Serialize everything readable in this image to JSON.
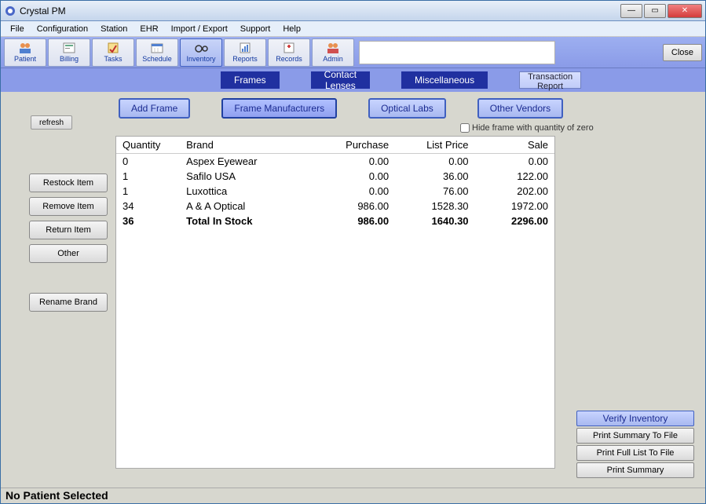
{
  "window": {
    "title": "Crystal PM"
  },
  "menubar": [
    "File",
    "Configuration",
    "Station",
    "EHR",
    "Import / Export",
    "Support",
    "Help"
  ],
  "toolbar": {
    "items": [
      {
        "label": "Patient",
        "name": "patient"
      },
      {
        "label": "Billing",
        "name": "billing"
      },
      {
        "label": "Tasks",
        "name": "tasks"
      },
      {
        "label": "Schedule",
        "name": "schedule"
      },
      {
        "label": "Inventory",
        "name": "inventory",
        "active": true
      },
      {
        "label": "Reports",
        "name": "reports"
      },
      {
        "label": "Records",
        "name": "records"
      },
      {
        "label": "Admin",
        "name": "admin"
      }
    ],
    "close_label": "Close"
  },
  "subnav": {
    "frames": "Frames",
    "contact_lenses": "Contact Lenses",
    "miscellaneous": "Miscellaneous",
    "tx_report": "Transaction Report"
  },
  "actions": {
    "refresh": "refresh",
    "add_frame": "Add Frame",
    "frame_manufacturers": "Frame Manufacturers",
    "optical_labs": "Optical Labs",
    "other_vendors": "Other Vendors",
    "hide_zero": "Hide frame with quantity of zero"
  },
  "side_buttons": {
    "restock": "Restock Item",
    "remove": "Remove Item",
    "return": "Return Item",
    "other": "Other",
    "rename": "Rename Brand"
  },
  "table": {
    "headers": {
      "quantity": "Quantity",
      "brand": "Brand",
      "purchase": "Purchase",
      "list_price": "List Price",
      "sale": "Sale"
    },
    "rows": [
      {
        "quantity": "0",
        "brand": "Aspex Eyewear",
        "purchase": "0.00",
        "list_price": "0.00",
        "sale": "0.00"
      },
      {
        "quantity": "1",
        "brand": "Safilo USA",
        "purchase": "0.00",
        "list_price": "36.00",
        "sale": "122.00"
      },
      {
        "quantity": "1",
        "brand": "Luxottica",
        "purchase": "0.00",
        "list_price": "76.00",
        "sale": "202.00"
      },
      {
        "quantity": "34",
        "brand": "A & A Optical",
        "purchase": "986.00",
        "list_price": "1528.30",
        "sale": "1972.00"
      }
    ],
    "total": {
      "quantity": "36",
      "brand": "Total In Stock",
      "purchase": "986.00",
      "list_price": "1640.30",
      "sale": "2296.00"
    }
  },
  "right_buttons": {
    "verify": "Verify Inventory",
    "print_summary_file": "Print Summary To File",
    "print_full_file": "Print Full List To File",
    "print_summary": "Print Summary"
  },
  "statusbar": "No Patient Selected"
}
